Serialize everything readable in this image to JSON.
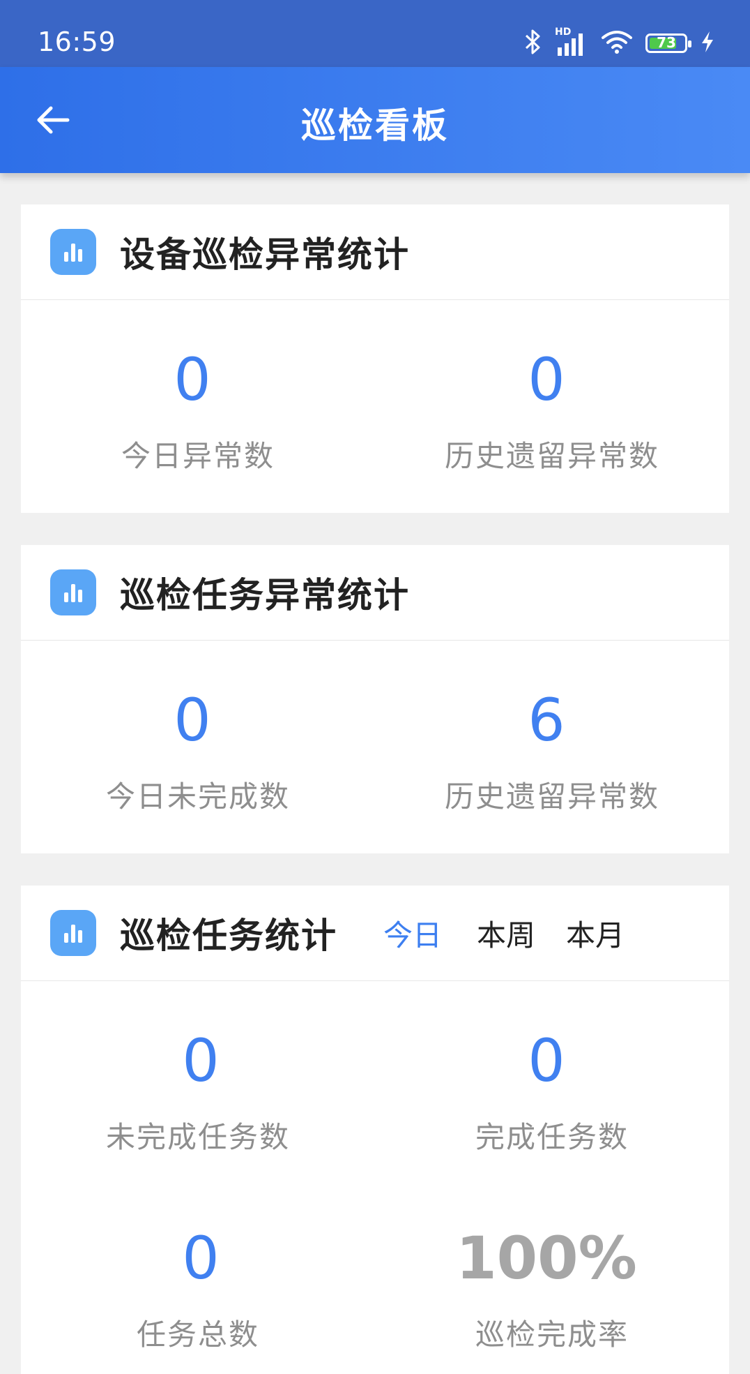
{
  "status_bar": {
    "time": "16:59",
    "hd_label": "HD",
    "battery_level": "73",
    "icons": [
      "bluetooth-icon",
      "signal-icon",
      "wifi-icon",
      "battery-icon",
      "charging-icon"
    ]
  },
  "app_bar": {
    "title": "巡检看板",
    "back_icon": "back-arrow-icon"
  },
  "colors": {
    "accent": "#3d7ff0",
    "header_gradient_start": "#2e6fe8",
    "header_gradient_end": "#4a8af5",
    "icon_bg": "#5aa6f6"
  },
  "cards": [
    {
      "title": "设备巡检异常统计",
      "stats": [
        {
          "value": "0",
          "label": "今日异常数"
        },
        {
          "value": "0",
          "label": "历史遗留异常数"
        }
      ]
    },
    {
      "title": "巡检任务异常统计",
      "stats": [
        {
          "value": "0",
          "label": "今日未完成数"
        },
        {
          "value": "6",
          "label": "历史遗留异常数"
        }
      ]
    },
    {
      "title": "巡检任务统计",
      "tabs": [
        {
          "label": "今日",
          "active": true
        },
        {
          "label": "本周",
          "active": false
        },
        {
          "label": "本月",
          "active": false
        }
      ],
      "stats": [
        {
          "value": "0",
          "label": "未完成任务数"
        },
        {
          "value": "0",
          "label": "完成任务数"
        },
        {
          "value": "0",
          "label": "任务总数"
        },
        {
          "value": "100%",
          "label": "巡检完成率"
        }
      ]
    }
  ]
}
